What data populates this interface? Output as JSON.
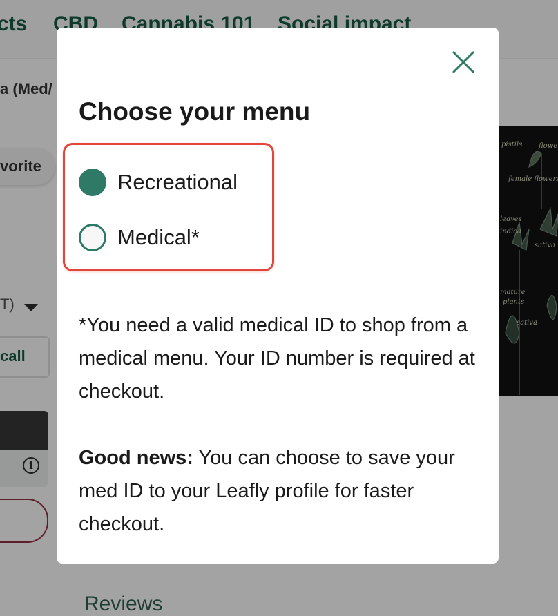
{
  "background": {
    "nav": {
      "items": [
        "cts",
        "CBD",
        "Cannabis 101",
        "Social impact"
      ]
    },
    "breadcrumb": "a (Med/",
    "favorite_label": "vorite",
    "select_text": "T)",
    "call_label": "call",
    "reviews_heading": "Reviews",
    "image_caption": [
      "pistils",
      "flowers",
      "female flowers",
      "leaves",
      "indica",
      "sativa",
      "mature",
      "plants",
      "sativa"
    ]
  },
  "modal": {
    "title": "Choose your menu",
    "close_icon": "close-icon",
    "options": [
      {
        "label": "Recreational",
        "checked": true
      },
      {
        "label": "Medical*",
        "checked": false
      }
    ],
    "note": "*You need a valid medical ID to shop from a medical menu. Your ID number is required at checkout.",
    "good_news_label": "Good news:",
    "good_news_text": " You can choose to save your med ID to your Leafly profile for faster checkout."
  },
  "colors": {
    "accent": "#2e7a66",
    "highlight": "#e2453a",
    "overlay": "#a3a3a3"
  }
}
